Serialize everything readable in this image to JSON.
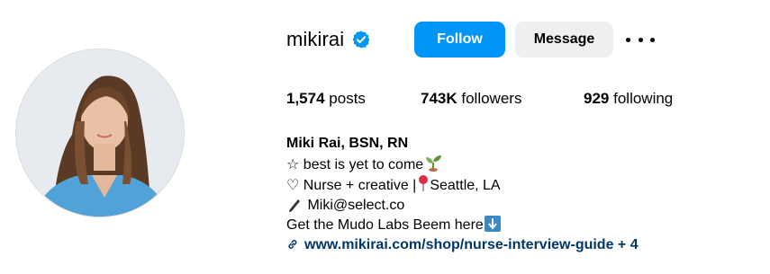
{
  "profile": {
    "username": "mikirai",
    "verified": true,
    "avatar_alt": "profile photo"
  },
  "actions": {
    "follow_label": "Follow",
    "message_label": "Message"
  },
  "stats": {
    "posts_count": "1,574",
    "posts_label": "posts",
    "followers_count": "743K",
    "followers_label": "followers",
    "following_count": "929",
    "following_label": "following"
  },
  "bio": {
    "name": "Miki Rai, BSN, RN",
    "line1": "☆ best is yet to come",
    "line2_prefix": "♡ Nurse + creative |",
    "line2_suffix": "Seattle, LA",
    "line3": "Miki@select.co",
    "line4": "Get the Mudo Labs Beem here",
    "link_text": "www.mikirai.com/shop/nurse-interview-guide + 4"
  },
  "colors": {
    "primary_button": "#0095f6",
    "secondary_button": "#efefef",
    "link": "#00376b",
    "verified_badge": "#0095f6"
  },
  "icons": {
    "verified": "verified-badge-icon",
    "more": "more-options-icon",
    "seedling": "seedling-icon",
    "pin": "round-pushpin-icon",
    "pen": "pen-icon",
    "arrow_down": "down-arrow-button-icon",
    "link": "link-icon"
  }
}
